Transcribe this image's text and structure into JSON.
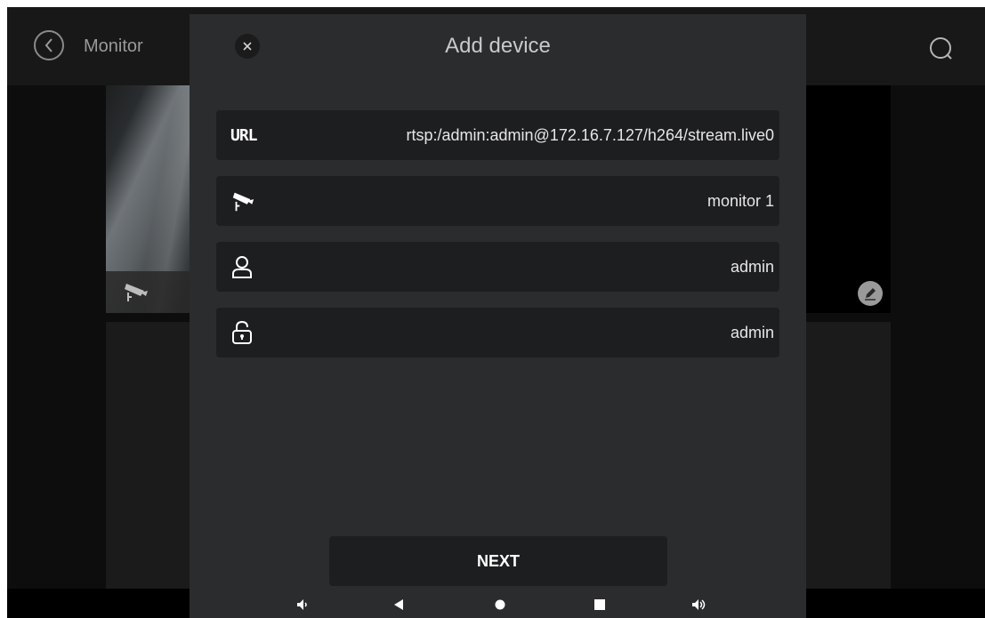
{
  "app": {
    "title": "Monitor",
    "back_icon": "chevron-left-icon",
    "refresh_icon": "refresh-icon",
    "tile_icon": "cctv-camera-icon",
    "edit_icon": "pencil-icon"
  },
  "dialog": {
    "title": "Add device",
    "close_icon": "close-icon",
    "fields": [
      {
        "icon": "url-label",
        "label": "URL",
        "value": "rtsp:/admin:admin@172.16.7.127/h264/stream.live0"
      },
      {
        "icon": "cctv-camera-icon",
        "value": "monitor 1"
      },
      {
        "icon": "user-icon",
        "value": "admin"
      },
      {
        "icon": "lock-icon",
        "value": "admin"
      }
    ],
    "next_label": "NEXT"
  },
  "nav": {
    "items": [
      "volume-down-icon",
      "back-triangle-icon",
      "home-circle-icon",
      "recents-square-icon",
      "volume-up-icon"
    ]
  },
  "colors": {
    "background": "#0d0d0d",
    "modal": "#2b2c2d",
    "field": "#1d1e1f",
    "text": "#e6e6e6"
  }
}
